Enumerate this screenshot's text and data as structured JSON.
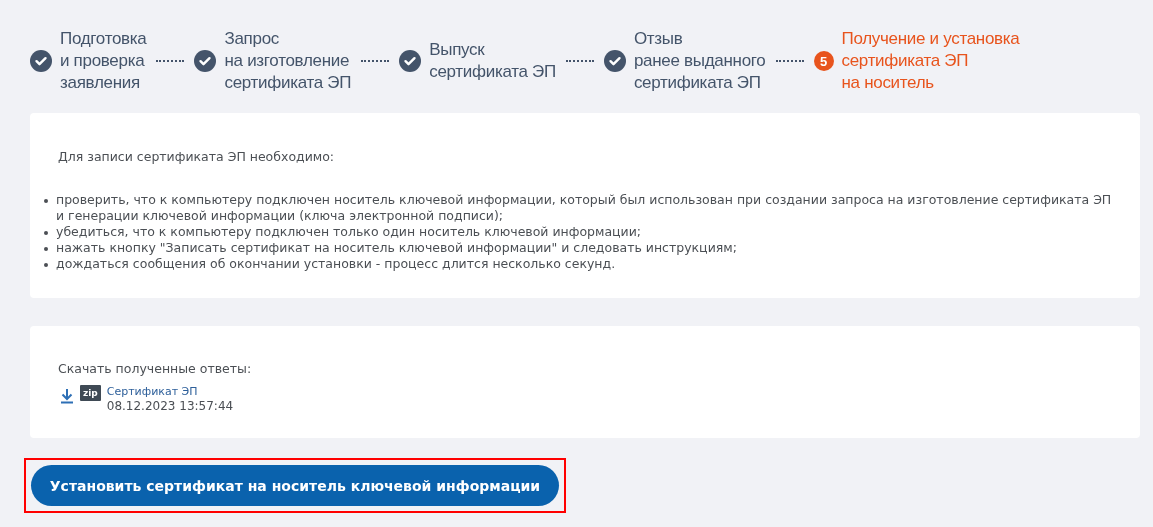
{
  "steps": [
    {
      "lines": [
        "Подготовка",
        "и проверка",
        "заявления"
      ],
      "done": true,
      "selected": false
    },
    {
      "lines": [
        "Запрос",
        "на изготовление",
        "сертификата ЭП"
      ],
      "done": true,
      "selected": false
    },
    {
      "lines": [
        "Выпуск",
        "сертификата ЭП"
      ],
      "done": true,
      "selected": false
    },
    {
      "lines": [
        "Отзыв",
        "ранее выданного",
        "сертификата ЭП"
      ],
      "done": true,
      "selected": false
    },
    {
      "lines": [
        "Получение и установка",
        "сертификата ЭП",
        "на носитель"
      ],
      "done": false,
      "selected": true,
      "number": "5"
    }
  ],
  "instructions": {
    "intro": "Для записи сертификата ЭП необходимо:",
    "items": [
      "проверить, что к компьютеру подключен носитель ключевой информации, который был использован при создании запроса на изготовление сертификата ЭП и генерации ключевой информации (ключа электронной подписи);",
      "убедиться, что к компьютеру подключен только один носитель ключевой информации;",
      "нажать кнопку \"Записать сертификат на носитель ключевой информации\" и следовать инструкциям;",
      "дождаться сообщения об окончании установки - процесс длится несколько секунд."
    ]
  },
  "downloads": {
    "label": "Скачать полученные ответы:",
    "files": [
      {
        "badge": "zip",
        "name": "Сертификат ЭП",
        "date": "08.12.2023 13:57:44"
      }
    ]
  },
  "install_button": {
    "label": "Установить сертификат на носитель ключевой информации",
    "highlighted": true
  }
}
